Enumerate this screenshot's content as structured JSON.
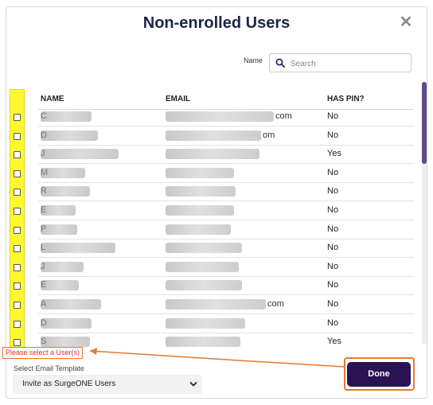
{
  "dialog": {
    "title": "Non-enrolled Users",
    "close_icon": "close-icon"
  },
  "search": {
    "label": "Name",
    "placeholder": "Search",
    "value": ""
  },
  "table": {
    "columns": [
      "NAME",
      "EMAIL",
      "HAS PIN?"
    ],
    "rows": [
      {
        "name_prefix": "C",
        "email_suffix": "com",
        "has_pin": "No"
      },
      {
        "name_prefix": "D",
        "email_suffix": "om",
        "has_pin": "No"
      },
      {
        "name_prefix": "J",
        "email_suffix": "",
        "has_pin": "Yes"
      },
      {
        "name_prefix": "M",
        "email_suffix": "",
        "has_pin": "No"
      },
      {
        "name_prefix": "R",
        "email_suffix": "",
        "has_pin": "No"
      },
      {
        "name_prefix": "E",
        "email_suffix": "",
        "has_pin": "No"
      },
      {
        "name_prefix": "P",
        "email_suffix": "",
        "has_pin": "No"
      },
      {
        "name_prefix": "L",
        "email_suffix": "",
        "has_pin": "No"
      },
      {
        "name_prefix": "J",
        "email_suffix": "",
        "has_pin": "No"
      },
      {
        "name_prefix": "E",
        "email_suffix": "",
        "has_pin": "No"
      },
      {
        "name_prefix": "A",
        "email_suffix": "com",
        "has_pin": "No"
      },
      {
        "name_prefix": "D",
        "email_suffix": "",
        "has_pin": "No"
      },
      {
        "name_prefix": "S",
        "email_suffix": "",
        "has_pin": "Yes"
      }
    ]
  },
  "validation": {
    "error_message": "Please select a User(s)"
  },
  "email_template": {
    "label": "Select Email Template",
    "selected": "Invite as SurgeONE Users"
  },
  "actions": {
    "done_label": "Done"
  },
  "colors": {
    "title": "#1e2348",
    "primary_button": "#2a1253",
    "annotation_orange": "#e8782f",
    "error_text": "#d6341f",
    "checkbox_highlight": "#fff830",
    "scroll_thumb": "#5f4c87"
  }
}
